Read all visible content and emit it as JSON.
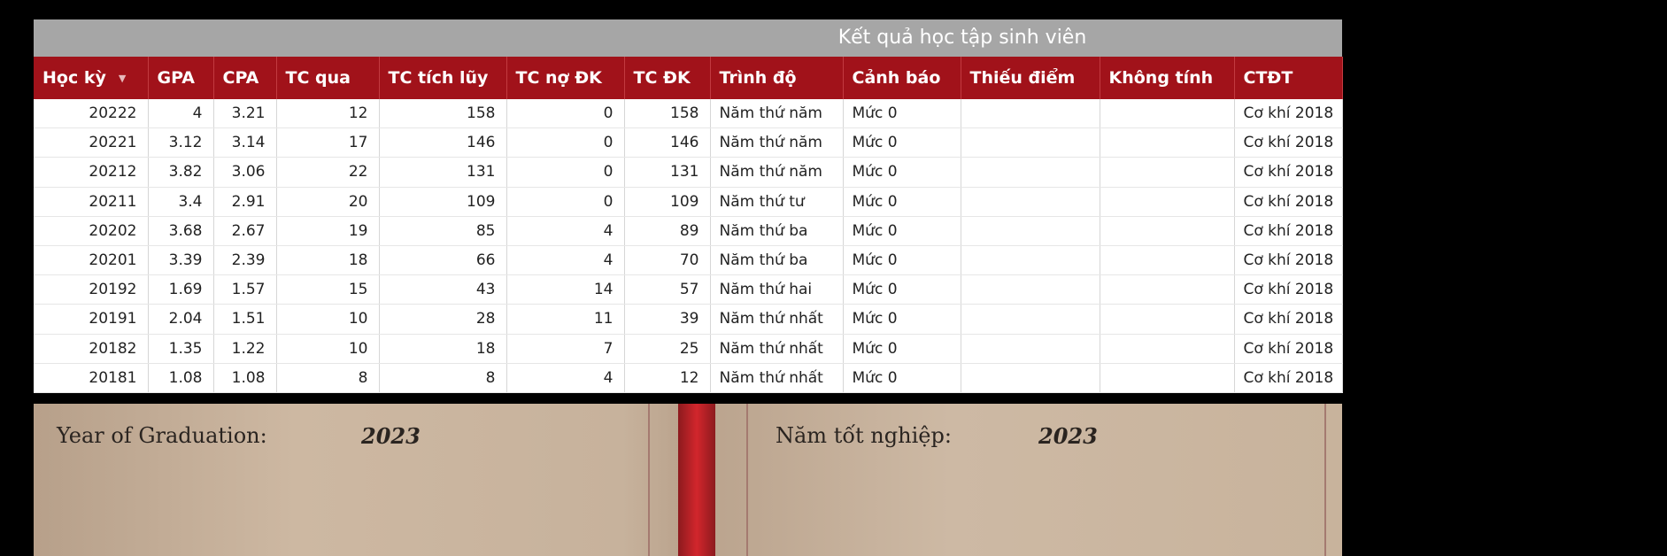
{
  "panel": {
    "title": "Kết quả học tập sinh viên"
  },
  "table": {
    "columns": [
      "Học kỳ",
      "GPA",
      "CPA",
      "TC qua",
      "TC tích lũy",
      "TC nợ ĐK",
      "TC ĐK",
      "Trình độ",
      "Cảnh báo",
      "Thiếu điểm",
      "Không tính",
      "CTĐT"
    ],
    "rows": [
      [
        "20222",
        "4",
        "3.21",
        "12",
        "158",
        "0",
        "158",
        "Năm thứ năm",
        "Mức 0",
        "",
        "",
        "Cơ khí 2018"
      ],
      [
        "20221",
        "3.12",
        "3.14",
        "17",
        "146",
        "0",
        "146",
        "Năm thứ năm",
        "Mức 0",
        "",
        "",
        "Cơ khí 2018"
      ],
      [
        "20212",
        "3.82",
        "3.06",
        "22",
        "131",
        "0",
        "131",
        "Năm thứ năm",
        "Mức 0",
        "",
        "",
        "Cơ khí 2018"
      ],
      [
        "20211",
        "3.4",
        "2.91",
        "20",
        "109",
        "0",
        "109",
        "Năm thứ tư",
        "Mức 0",
        "",
        "",
        "Cơ khí 2018"
      ],
      [
        "20202",
        "3.68",
        "2.67",
        "19",
        "85",
        "4",
        "89",
        "Năm thứ ba",
        "Mức 0",
        "",
        "",
        "Cơ khí 2018"
      ],
      [
        "20201",
        "3.39",
        "2.39",
        "18",
        "66",
        "4",
        "70",
        "Năm thứ ba",
        "Mức 0",
        "",
        "",
        "Cơ khí 2018"
      ],
      [
        "20192",
        "1.69",
        "1.57",
        "15",
        "43",
        "14",
        "57",
        "Năm thứ hai",
        "Mức 0",
        "",
        "",
        "Cơ khí 2018"
      ],
      [
        "20191",
        "2.04",
        "1.51",
        "10",
        "28",
        "11",
        "39",
        "Năm thứ nhất",
        "Mức 0",
        "",
        "",
        "Cơ khí 2018"
      ],
      [
        "20182",
        "1.35",
        "1.22",
        "10",
        "18",
        "7",
        "25",
        "Năm thứ nhất",
        "Mức 0",
        "",
        "",
        "Cơ khí 2018"
      ],
      [
        "20181",
        "1.08",
        "1.08",
        "8",
        "8",
        "4",
        "12",
        "Năm thứ nhất",
        "Mức 0",
        "",
        "",
        "Cơ khí 2018"
      ]
    ]
  },
  "certificate": {
    "left_label": "Year of Graduation:",
    "left_year": "2023",
    "right_label": "Năm tốt nghiệp:",
    "right_year": "2023"
  },
  "colors": {
    "header_bg": "#a1121a",
    "title_bar_bg": "#a6a6a6"
  },
  "icons": {
    "sort": "sort-down-icon"
  }
}
